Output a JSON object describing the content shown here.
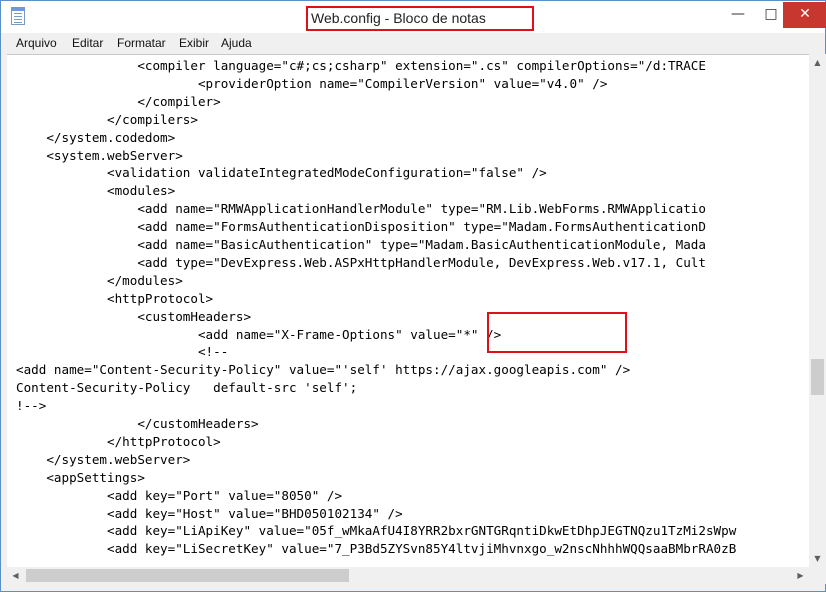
{
  "window": {
    "title": "Web.config - Bloco de notas",
    "controls": {
      "minimize": "—",
      "maximize": "□",
      "close": "✕"
    }
  },
  "menu": [
    "Arquivo",
    "Editar",
    "Formatar",
    "Exibir",
    "Ajuda"
  ],
  "editor": {
    "lines": [
      "                <compiler language=\"c#;cs;csharp\" extension=\".cs\" compilerOptions=\"/d:TRACE",
      "                        <providerOption name=\"CompilerVersion\" value=\"v4.0\" />",
      "                </compiler>",
      "            </compilers>",
      "    </system.codedom>",
      "    <system.webServer>",
      "            <validation validateIntegratedModeConfiguration=\"false\" />",
      "            <modules>",
      "                <add name=\"RMWApplicationHandlerModule\" type=\"RM.Lib.WebForms.RMWApplicatio",
      "                <add name=\"FormsAuthenticationDisposition\" type=\"Madam.FormsAuthenticationD",
      "                <add name=\"BasicAuthentication\" type=\"Madam.BasicAuthenticationModule, Mada",
      "                <add type=\"DevExpress.Web.ASPxHttpHandlerModule, DevExpress.Web.v17.1, Cult",
      "            </modules>",
      "            <httpProtocol>",
      "                <customHeaders>",
      "                        <add name=\"X-Frame-Options\" value=\"*\" />",
      "                        <!--",
      "<add name=\"Content-Security-Policy\" value=\"'self' https://ajax.googleapis.com\" />",
      "Content-Security-Policy   default-src 'self';",
      "!-->",
      "                </customHeaders>",
      "            </httpProtocol>",
      "    </system.webServer>",
      "    <appSettings>",
      "            <add key=\"Port\" value=\"8050\" />",
      "            <add key=\"Host\" value=\"BHD050102134\" />",
      "            <add key=\"LiApiKey\" value=\"05f_wMkaAfU4I8YRR2bxrGNTGRqntiDkwEtDhpJEGTNQzu1TzMi2sWpw",
      "            <add key=\"LiSecretKey\" value=\"7_P3Bd5ZYSvn85Y4ltvjiMhvnxgo_w2nscNhhhWQQsaaBMbrRA0zB"
    ]
  },
  "scrollbars": {
    "up": "▲",
    "down": "▼",
    "left": "◀",
    "right": "▶"
  }
}
